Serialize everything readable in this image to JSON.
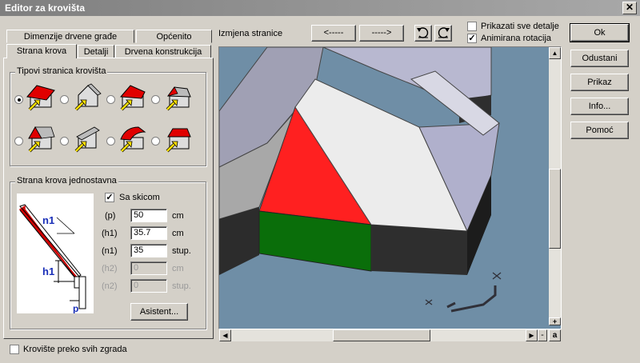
{
  "window": {
    "title": "Editor za krovišta",
    "close_glyph": "✕"
  },
  "tabs": {
    "row1": [
      {
        "label": "Dimenzije drvene građe"
      },
      {
        "label": "Općenito"
      }
    ],
    "row2": [
      {
        "label": "Strana krova",
        "active": true
      },
      {
        "label": "Detalji"
      },
      {
        "label": "Drvena konstrukcija"
      }
    ]
  },
  "roof_types": {
    "legend": "Tipovi stranica krovišta",
    "selected_index": 0,
    "options": [
      "gable-roof-side",
      "gable-end-wall",
      "hip-roof-side",
      "hip-roof-small",
      "hip-end-triangle",
      "shed-side",
      "curved-roof",
      "dormer-roof"
    ]
  },
  "simple_side": {
    "legend": "Strana krova jednostavna",
    "sketch_checkbox": {
      "label": "Sa skicom",
      "checked": true
    },
    "sketch_labels": {
      "n1": "n1",
      "h1": "h1",
      "p": "p"
    },
    "params": [
      {
        "label": "(p)",
        "value": "50",
        "unit": "cm",
        "enabled": true
      },
      {
        "label": "(h1)",
        "value": "35.7",
        "unit": "cm",
        "enabled": true
      },
      {
        "label": "(n1)",
        "value": "35",
        "unit": "stup.",
        "enabled": true
      },
      {
        "label": "(h2)",
        "value": "0",
        "unit": "cm",
        "enabled": false
      },
      {
        "label": "(n2)",
        "value": "0",
        "unit": "stup.",
        "enabled": false
      }
    ],
    "assistant_button": "Asistent..."
  },
  "bottom_checkbox": {
    "label": "Krovište preko svih zgrada",
    "checked": false
  },
  "viewer": {
    "page_change_label": "Izmjena stranice",
    "prev_button": "<-----",
    "next_button": "----->",
    "rotate_left_icon": "rotate-left-icon",
    "rotate_right_icon": "rotate-right-icon",
    "show_all_details": {
      "label": "Prikazati sve detalje",
      "checked": false
    },
    "animated_rotation": {
      "label": "Animirana rotacija",
      "checked": true
    },
    "zoom_plus": "+",
    "zoom_minus": "-",
    "zoom_auto": "a"
  },
  "right_buttons": {
    "ok": "Ok",
    "cancel": "Odustani",
    "show": "Prikaz",
    "info": "Info...",
    "help": "Pomoć"
  },
  "colors": {
    "selected_roof_face": "#ff2020",
    "wall_below_face": "#0a6e0a",
    "background_3d": "#6f8ea6"
  }
}
